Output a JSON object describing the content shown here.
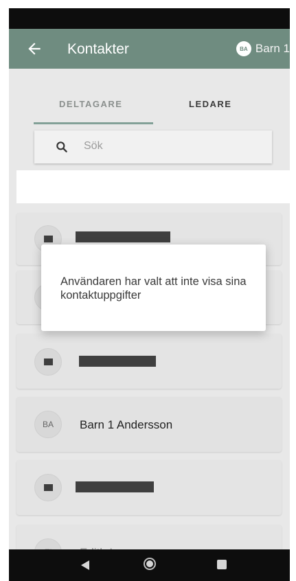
{
  "header": {
    "title": "Kontakter",
    "profile_initials": "BA",
    "profile_name": "Barn 1"
  },
  "tabs": [
    {
      "label": "DELTAGARE",
      "active": true
    },
    {
      "label": "LEDARE",
      "active": false
    }
  ],
  "search": {
    "placeholder": "Sök"
  },
  "contacts": [
    {
      "initials": "",
      "name": "",
      "redacted": true
    },
    {
      "initials": "",
      "name": "",
      "redacted": true
    },
    {
      "initials": "",
      "name": "",
      "redacted": true
    },
    {
      "initials": "BA",
      "name": "Barn 1 Andersson",
      "redacted": false
    },
    {
      "initials": "",
      "name": "",
      "redacted": true
    },
    {
      "initials": "El",
      "name": "Edith Larsson",
      "redacted": false,
      "partially_hidden": true
    }
  ],
  "dialog": {
    "message": "Användaren har valt att inte visa sina kontaktuppgifter"
  },
  "colors": {
    "app_bar": "#6f8c80",
    "tab_indicator": "#82a097",
    "overlay_background": "#e8e8e8"
  }
}
